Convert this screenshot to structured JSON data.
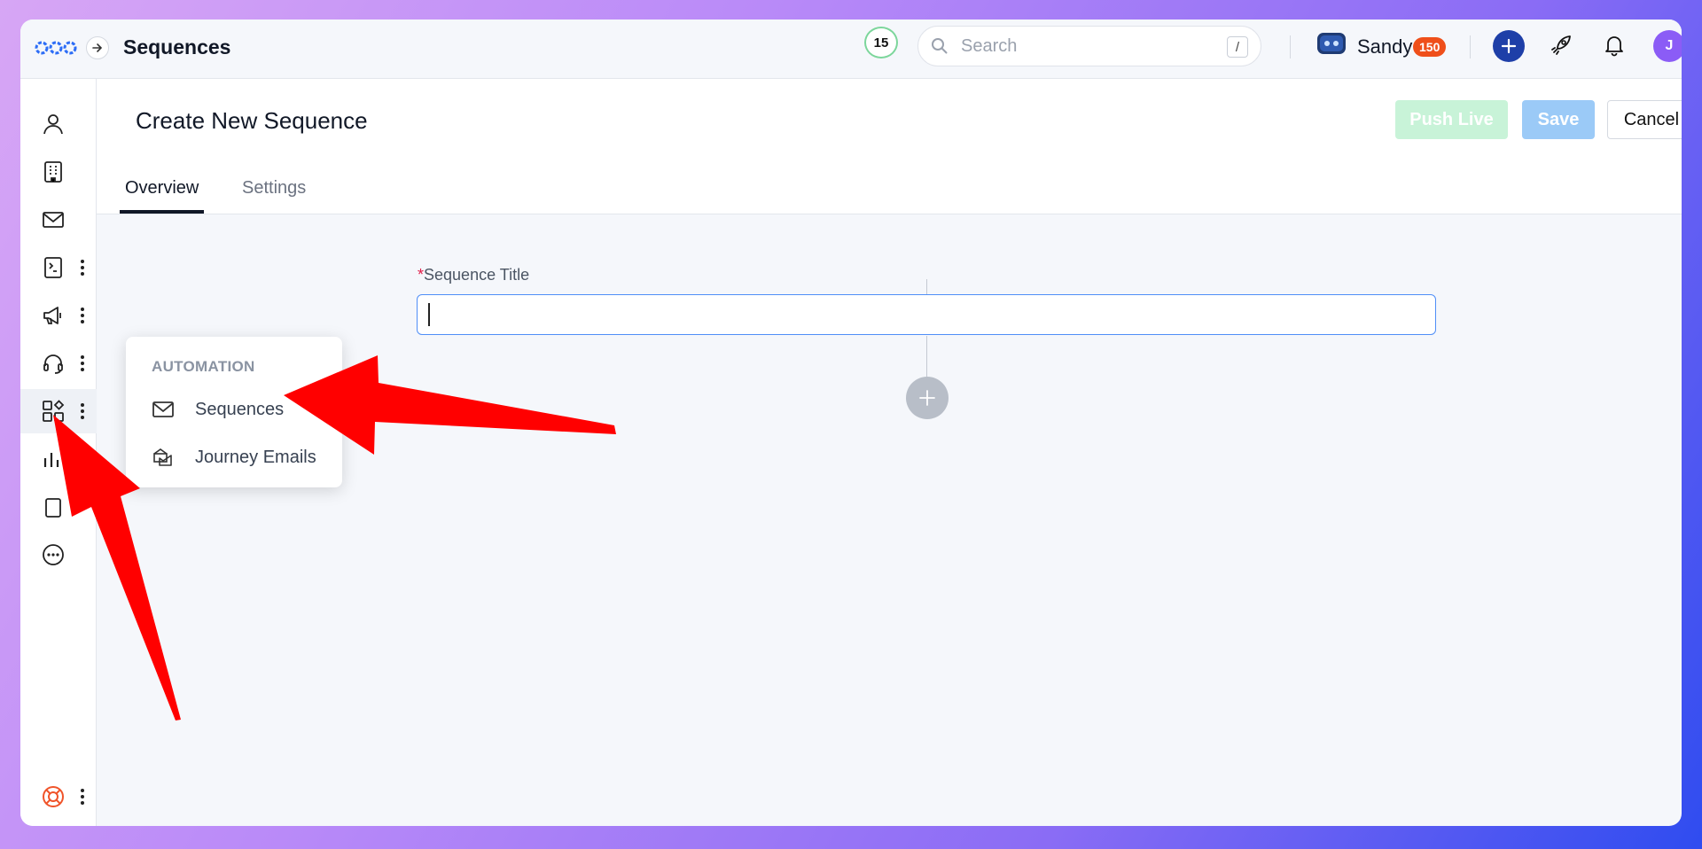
{
  "topbar": {
    "app_title": "Sequences",
    "count_badge": "15",
    "search_placeholder": "Search",
    "search_shortcut": "/",
    "user_name": "Sandy",
    "credit_badge": "150",
    "avatar_initial": "J"
  },
  "header": {
    "page_title": "Create New Sequence",
    "push_live_label": "Push Live",
    "save_label": "Save",
    "cancel_label": "Cancel",
    "tabs": [
      {
        "label": "Overview",
        "active": true
      },
      {
        "label": "Settings",
        "active": false
      }
    ]
  },
  "form": {
    "required_mark": "*",
    "title_label": "Sequence Title",
    "title_value": ""
  },
  "popup": {
    "heading": "AUTOMATION",
    "items": [
      {
        "label": "Sequences",
        "icon": "mail-icon"
      },
      {
        "label": "Journey Emails",
        "icon": "journey-email-icon"
      }
    ]
  },
  "sidebar": {
    "items": [
      {
        "icon": "person-icon"
      },
      {
        "icon": "building-icon"
      },
      {
        "icon": "mail-icon"
      },
      {
        "icon": "invoice-icon"
      },
      {
        "icon": "megaphone-icon"
      },
      {
        "icon": "headset-icon"
      },
      {
        "icon": "apps-icon",
        "active": true
      },
      {
        "icon": "chart-icon"
      },
      {
        "icon": "clipboard-icon"
      },
      {
        "icon": "more-icon"
      },
      {
        "icon": "lifebuoy-icon"
      }
    ]
  },
  "colors": {
    "brand_blue": "#1e3fa8",
    "accent_input": "#4f8ef7",
    "push_live_bg": "#c8f3d8",
    "save_bg": "#9bcaf7",
    "credit_badge_bg": "#ef4f1a",
    "avatar_bg": "#8b5cf6",
    "annotation_arrow": "#ff0000"
  }
}
